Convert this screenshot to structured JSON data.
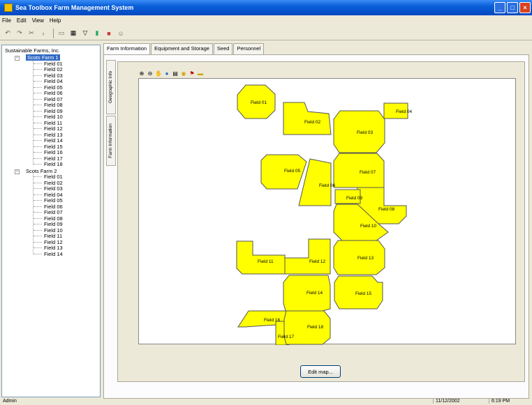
{
  "window": {
    "title": "Sea Toolbox Farm Management System"
  },
  "menu": [
    "File",
    "Edit",
    "View",
    "Help"
  ],
  "toolbar": {
    "icons": [
      "undo-icon",
      "redo-icon",
      "cut-icon",
      "paste-icon",
      "separator",
      "new-icon",
      "list-icon",
      "filter-icon",
      "chart-icon",
      "palette-icon",
      "people-icon"
    ]
  },
  "tree": {
    "root": "Sustainable Farms, Inc.",
    "farms": [
      {
        "name": "Scots Farm 1",
        "selected": true,
        "fields": [
          "Field 01",
          "Field 02",
          "Field 03",
          "Field 04",
          "Field 05",
          "Field 06",
          "Field 07",
          "Field 08",
          "Field 09",
          "Field 10",
          "Field 11",
          "Field 12",
          "Field 13",
          "Field 14",
          "Field 15",
          "Field 16",
          "Field 17",
          "Field 18"
        ]
      },
      {
        "name": "Scots Farm 2",
        "selected": false,
        "fields": [
          "Field 01",
          "Field 02",
          "Field 03",
          "Field 04",
          "Field 05",
          "Field 06",
          "Field 07",
          "Field 08",
          "Field 09",
          "Field 10",
          "Field 11",
          "Field 12",
          "Field 13",
          "Field 14"
        ]
      }
    ]
  },
  "tabs": [
    "Farm Information",
    "Equipment and Storage",
    "Seed",
    "Personnel"
  ],
  "vtabs": [
    "Geographic Info",
    "Farm Information"
  ],
  "map": {
    "fill_color": "#ffff00",
    "stroke_color": "#555555",
    "tools": [
      "zoom-in-icon",
      "zoom-out-icon",
      "pan-icon",
      "globe-icon",
      "print-icon",
      "target-icon",
      "flag-icon",
      "label-icon"
    ],
    "labels": {
      "f01": "Field 01",
      "f02": "Field 02",
      "f03": "Field 03",
      "f04": "Field 04",
      "f05": "Field 05",
      "f06": "Field 06",
      "f07": "Field 07",
      "f08": "Field 08",
      "f09": "Field 09",
      "f10": "Field 10",
      "f11": "Field 11",
      "f12": "Field 12",
      "f13": "Field 13",
      "f14": "Field 14",
      "f15": "Field 15",
      "f16": "Field 16",
      "f17": "Field 17",
      "f18": "Field 18"
    }
  },
  "buttons": {
    "edit_map": "Edit map..."
  },
  "status": {
    "user": "Admin",
    "date": "11/12/2002",
    "time": "6:19 PM"
  }
}
